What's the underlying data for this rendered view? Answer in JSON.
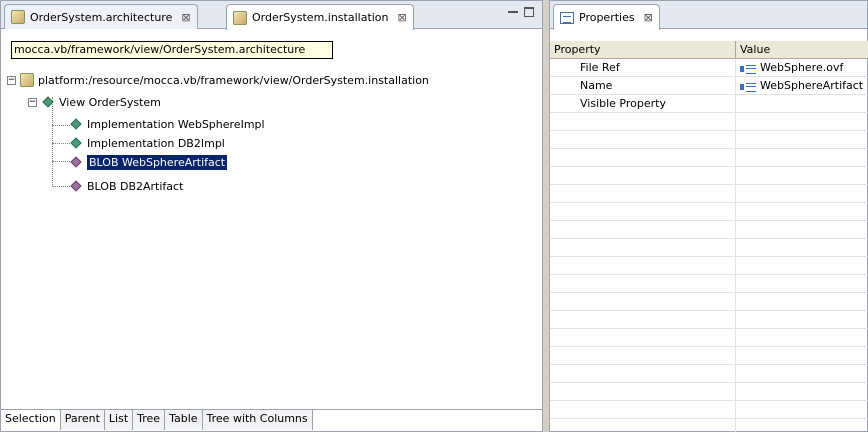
{
  "editor": {
    "tabs": [
      {
        "label": "OrderSystem.architecture",
        "close": "⊠"
      },
      {
        "label": "OrderSystem.installation",
        "close": "⊠"
      }
    ],
    "path_tooltip": "mocca.vb/framework/view/OrderSystem.architecture",
    "tree": {
      "root": "platform:/resource/mocca.vb/framework/view/OrderSystem.installation",
      "view": "View OrderSystem",
      "children": [
        "Implementation WebSphereImpl",
        "Implementation DB2Impl",
        "BLOB WebSphereArtifact",
        "BLOB DB2Artifact"
      ]
    },
    "bottom_tabs": [
      "Selection",
      "Parent",
      "List",
      "Tree",
      "Table",
      "Tree with Columns"
    ]
  },
  "properties": {
    "tab_label": "Properties",
    "tab_close": "⊠",
    "columns": [
      "Property",
      "Value"
    ],
    "rows": [
      {
        "property": "File Ref",
        "value": "WebSphere.ovf"
      },
      {
        "property": "Name",
        "value": "WebSphereArtifact"
      },
      {
        "property": "Visible Property",
        "value": ""
      }
    ]
  }
}
